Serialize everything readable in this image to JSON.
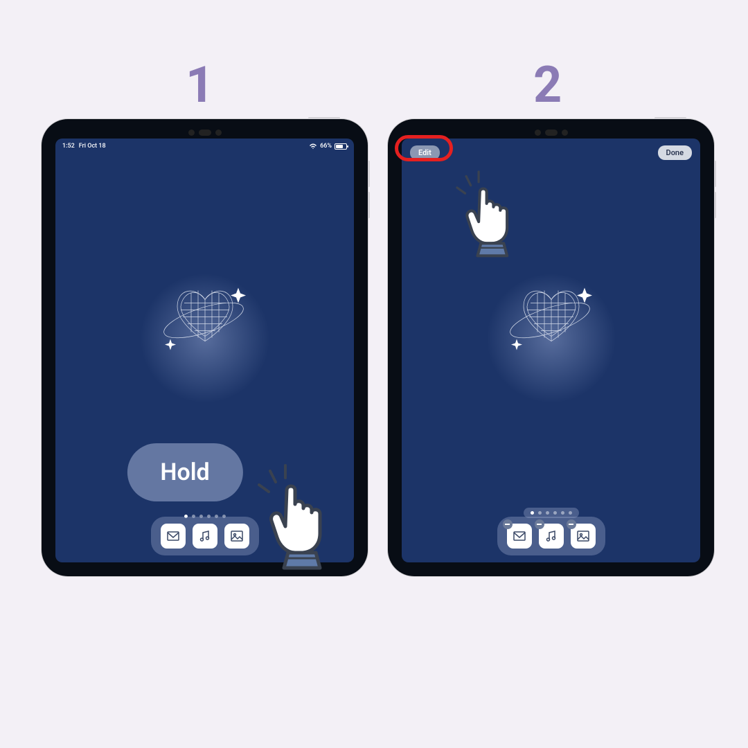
{
  "steps": {
    "one": "1",
    "two": "2"
  },
  "statusbar": {
    "time": "1:52",
    "date": "Fri Oct 18",
    "battery": "66%"
  },
  "hold_button": {
    "label": "Hold"
  },
  "editbar": {
    "edit_label": "Edit",
    "done_label": "Done"
  },
  "dock": {
    "icons": [
      "mail-icon",
      "music-icon",
      "photos-icon"
    ]
  },
  "page_indicator": {
    "count": 6,
    "active": 0
  },
  "colors": {
    "background": "#f3f0f6",
    "step_label": "#8b7bb5",
    "screen": "#1c3468",
    "highlight": "#e52020"
  }
}
